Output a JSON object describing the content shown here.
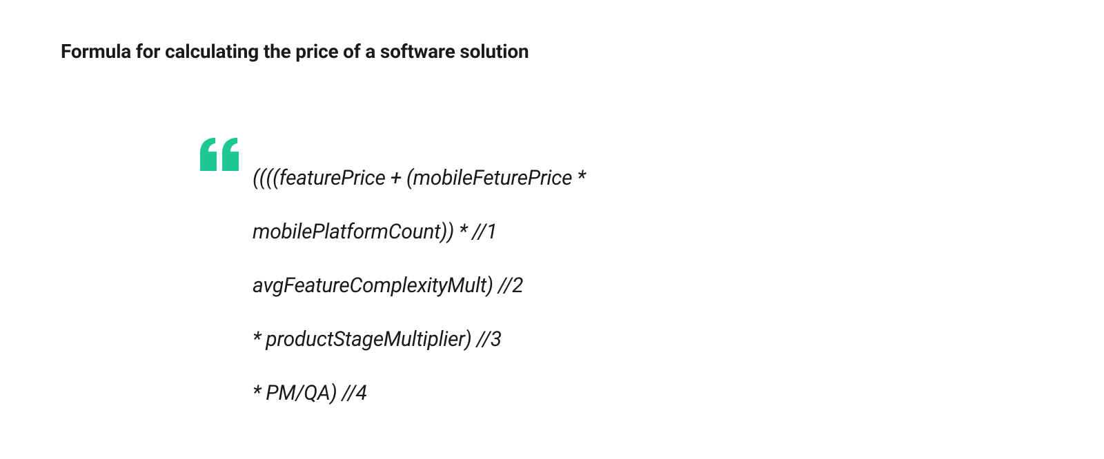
{
  "heading": "Formula for calculating the price of a software solution",
  "quote": {
    "line1": "((((featurePrice + (mobileFeturePrice *",
    "line2": "mobilePlatformCount)) * //1",
    "line3": "avgFeatureComplexityMult) //2",
    "line4": "* productStageMultiplier) //3",
    "line5": "* PM/QA) //4"
  },
  "colors": {
    "accent": "#1ec895"
  }
}
